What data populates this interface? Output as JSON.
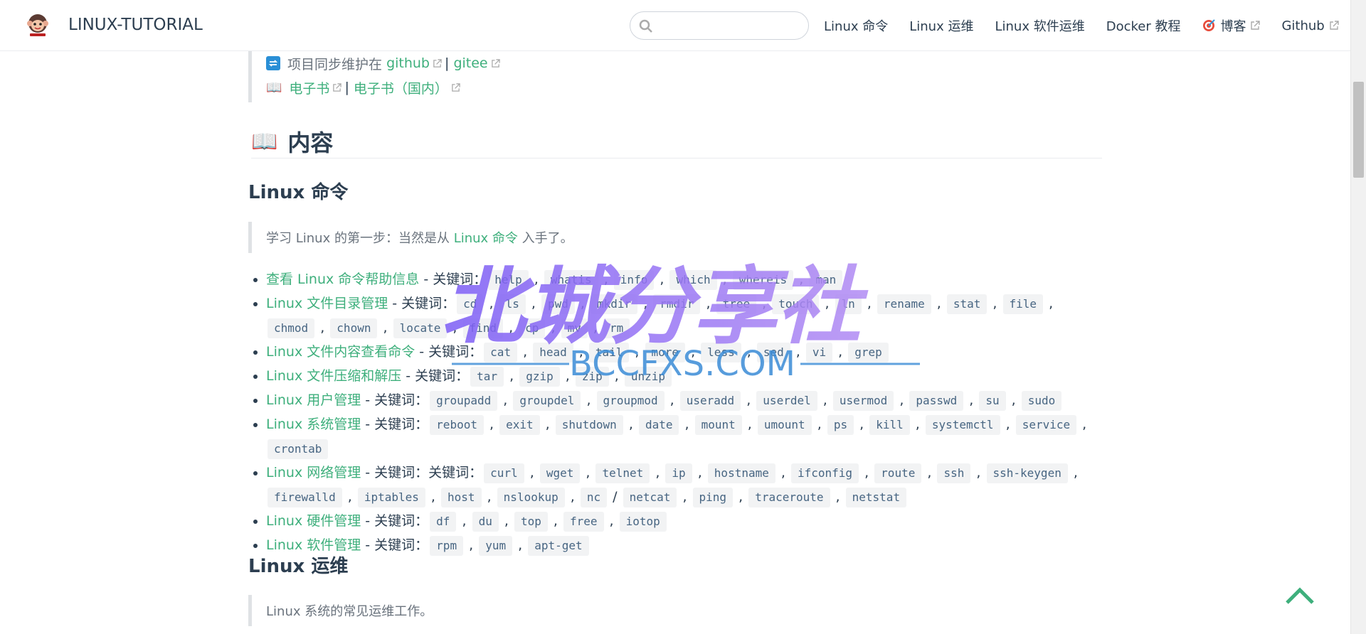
{
  "navbar": {
    "site_name": "LINUX-TUTORIAL",
    "search_placeholder": "",
    "links": [
      {
        "label": "Linux 命令",
        "external": false
      },
      {
        "label": "Linux 运维",
        "external": false
      },
      {
        "label": "Linux 软件运维",
        "external": false
      },
      {
        "label": "Docker 教程",
        "external": false
      },
      {
        "label": "博客",
        "external": true
      },
      {
        "label": "Github",
        "external": true
      }
    ]
  },
  "intro": {
    "sync_prefix": "项目同步维护在",
    "github": "github",
    "sep": "|",
    "gitee": "gitee",
    "ebook": "电子书",
    "ebook_cn": "电子书（国内）"
  },
  "section_title": "内容",
  "linux_cmd": {
    "heading": "Linux 命令",
    "quote_prefix": "学习 Linux 的第一步：当然是从",
    "quote_link": "Linux 命令",
    "quote_suffix": "入手了。",
    "items": [
      {
        "link": "查看 Linux 命令帮助信息",
        "label": " - 关键词：",
        "keywords": [
          "help",
          "whatis",
          "info",
          "which",
          "whereis",
          "man"
        ]
      },
      {
        "link": "Linux 文件目录管理",
        "label": " - 关键词：",
        "keywords": [
          "cd",
          "ls",
          "pwd",
          "mkdir",
          "rmdir",
          "tree",
          "touch",
          "ln",
          "rename",
          "stat",
          "file",
          "chmod",
          "chown",
          "locate",
          "find",
          "cp",
          "mv",
          "rm"
        ]
      },
      {
        "link": "Linux 文件内容查看命令",
        "label": " - 关键词：",
        "keywords": [
          "cat",
          "head",
          "tail",
          "more",
          "less",
          "sed",
          "vi",
          "grep"
        ]
      },
      {
        "link": "Linux 文件压缩和解压",
        "label": " - 关键词：",
        "keywords": [
          "tar",
          "gzip",
          "zip",
          "unzip"
        ]
      },
      {
        "link": "Linux 用户管理",
        "label": " - 关键词：",
        "keywords": [
          "groupadd",
          "groupdel",
          "groupmod",
          "useradd",
          "userdel",
          "usermod",
          "passwd",
          "su",
          "sudo"
        ]
      },
      {
        "link": "Linux 系统管理",
        "label": " - 关键词：",
        "keywords": [
          "reboot",
          "exit",
          "shutdown",
          "date",
          "mount",
          "umount",
          "ps",
          "kill",
          "systemctl",
          "service",
          "crontab"
        ]
      },
      {
        "link": "Linux 网络管理",
        "label": " - 关键词：关键词：",
        "keywords": [
          "curl",
          "wget",
          "telnet",
          "ip",
          "hostname",
          "ifconfig",
          "route",
          "ssh",
          "ssh-keygen",
          "firewalld",
          "iptables",
          "host",
          "nslookup",
          "nc",
          "netcat",
          "ping",
          "traceroute",
          "netstat"
        ]
      },
      {
        "link": "Linux 硬件管理",
        "label": " - 关键词：",
        "keywords": [
          "df",
          "du",
          "top",
          "free",
          "iotop"
        ]
      },
      {
        "link": "Linux 软件管理",
        "label": " - 关键词：",
        "keywords": [
          "rpm",
          "yum",
          "apt-get"
        ]
      }
    ]
  },
  "linux_ops": {
    "heading": "Linux 运维",
    "quote": "Linux 系统的常见运维工作。"
  },
  "watermark": {
    "main": "北城分享社",
    "sub": "BCCFXS.COM"
  }
}
